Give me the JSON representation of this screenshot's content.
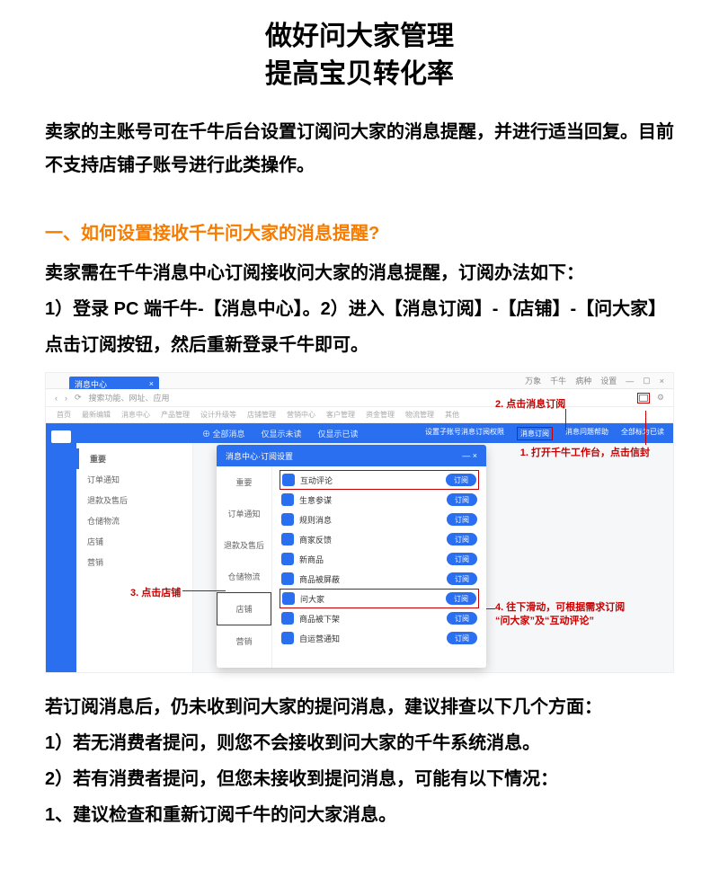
{
  "title_l1": "做好问大家管理",
  "title_l2": "提高宝贝转化率",
  "intro": "卖家的主账号可在千牛后台设置订阅问大家的消息提醒，并进行适当回复。目前不支持店铺子账号进行此类操作。",
  "section1_heading": "一、如何设置接收千牛问大家的消息提醒?",
  "body1": "卖家需在千牛消息中心订阅接收问大家的消息提醒，订阅办法如下：",
  "body2": "1）登录 PC 端千牛-【消息中心】。2）进入【消息订阅】-【店铺】-【问大家】点击订阅按钮，然后重新登录千牛即可。",
  "after1": "若订阅消息后，仍未收到问大家的提问消息，建议排查以下几个方面：",
  "after2": "1）若无消费者提问，则您不会接收到问大家的千牛系统消息。",
  "after3": "2）若有消费者提问，但您未接收到提问消息，可能有以下情况：",
  "after4": "1、建议检查和重新订阅千牛的问大家消息。",
  "shot": {
    "titlebar_items": [
      "万象",
      "千牛",
      "病种",
      "设置"
    ],
    "tab_label": "消息中心",
    "tab_close": "×",
    "search_placeholder": "搜索功能、网址、应用",
    "nav": [
      "首页",
      "最新编辑",
      "消息中心",
      "产品管理",
      "设计升级等",
      "店铺管理",
      "营销中心",
      "客户管理",
      "资金管理",
      "物流管理",
      "其他"
    ],
    "bluebar_left": [
      "⊕ 全部消息",
      "仅显示未读",
      "仅显示已读"
    ],
    "bluebar_right": [
      "设置子账号消息订阅权限",
      "消息订阅",
      "消息问题帮助",
      "全部标为已读"
    ],
    "side": [
      "重要",
      "订单通知",
      "退款及售后",
      "仓储物流",
      "店铺",
      "营销"
    ],
    "modal_title": "消息中心·订阅设置",
    "modal_close": "— ×",
    "modal_cats": [
      "重要",
      "订单通知",
      "退款及售后",
      "仓储物流",
      "店铺",
      "营销"
    ],
    "rows": [
      {
        "label": "互动评论",
        "btn": "订阅"
      },
      {
        "label": "生意参谋",
        "btn": "订阅"
      },
      {
        "label": "规则消息",
        "btn": "订阅"
      },
      {
        "label": "商家反馈",
        "btn": "订阅"
      },
      {
        "label": "新商品",
        "btn": "订阅"
      },
      {
        "label": "商品被屏蔽",
        "btn": "订阅"
      },
      {
        "label": "问大家",
        "btn": "订阅"
      },
      {
        "label": "商品被下架",
        "btn": "订阅"
      },
      {
        "label": "自运营通知",
        "btn": "订阅"
      }
    ],
    "note1": "1. 打开千牛工作台，点击信封",
    "note2": "2. 点击消息订阅",
    "note3": "3. 点击店铺",
    "note4a": "4. 往下滑动，可根据需求订阅",
    "note4b": "“问大家”及“互动评论”"
  }
}
